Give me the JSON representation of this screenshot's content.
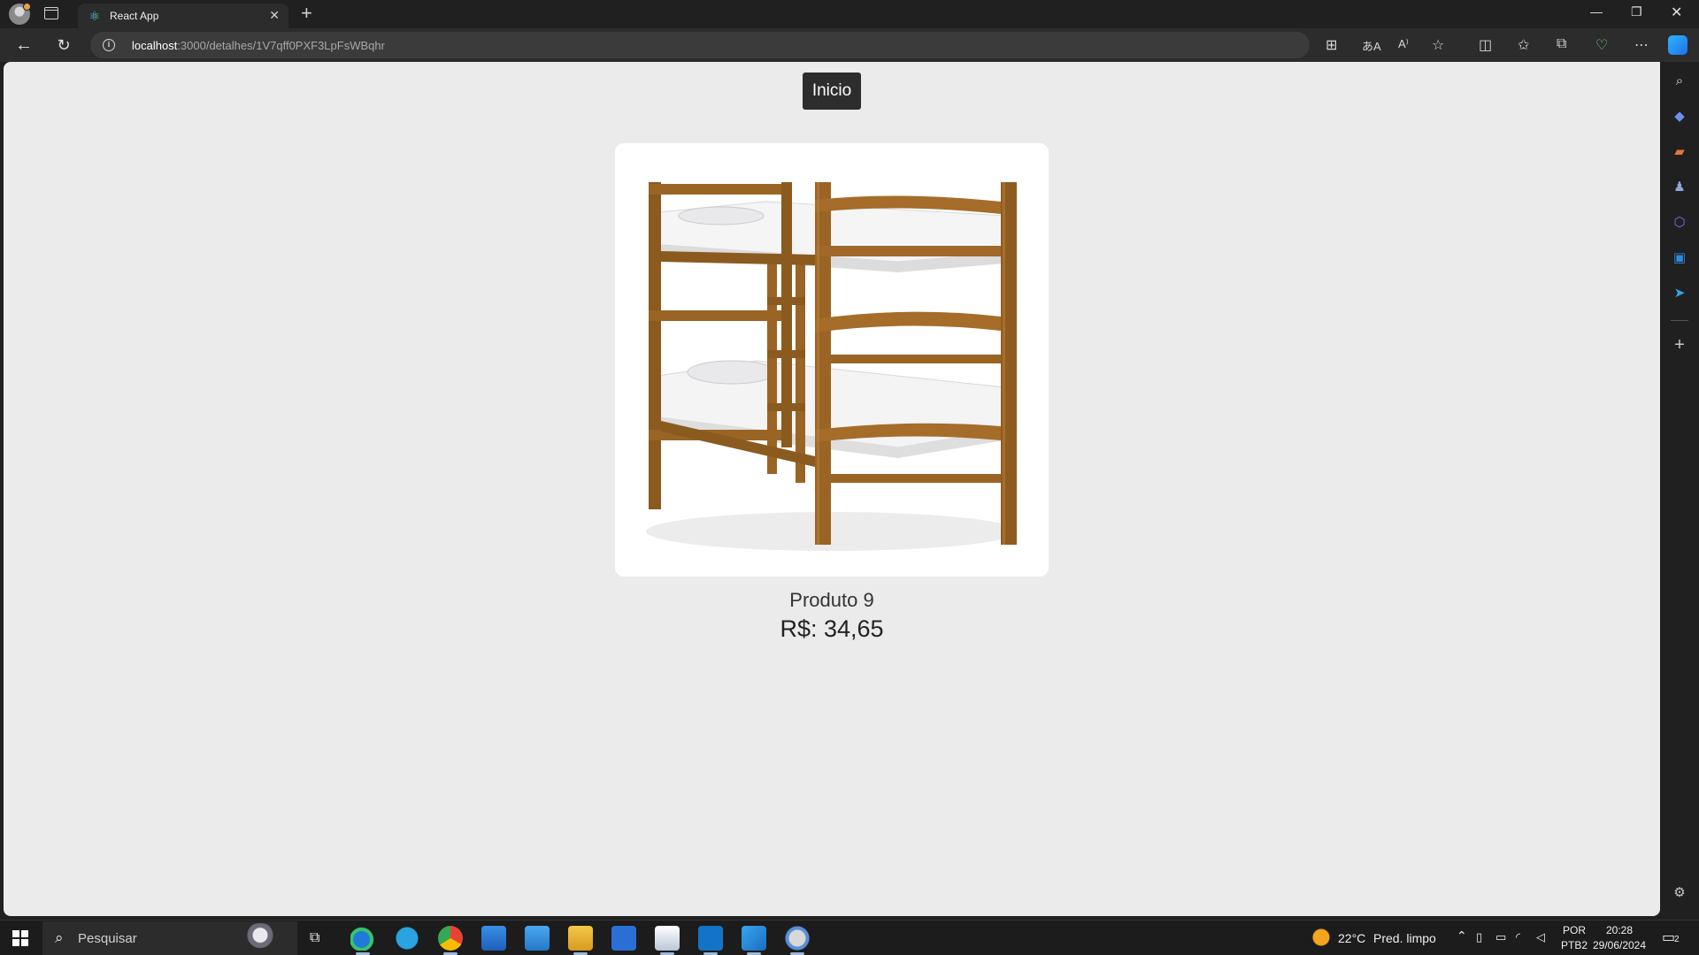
{
  "browser": {
    "tab": {
      "title": "React App"
    },
    "address": {
      "host": "localhost",
      "path": ":3000/detalhes/1V7qff0PXF3LpFsWBqhr"
    }
  },
  "page": {
    "home_button": "Inicio",
    "product": {
      "name": "Produto 9",
      "price": "R$: 34,65",
      "image_icon": "bunk-bed-image"
    }
  },
  "taskbar": {
    "search_placeholder": "Pesquisar",
    "weather": {
      "temp": "22°C",
      "desc": "Pred. limpo"
    },
    "language": {
      "lang": "POR",
      "layout": "PTB2"
    },
    "clock": {
      "time": "20:28",
      "date": "29/06/2024"
    },
    "notifications": "2"
  },
  "colors": {
    "page_bg": "#ebebeb",
    "home_button_bg": "#2d2d2d",
    "browser_chrome": "#202020"
  }
}
